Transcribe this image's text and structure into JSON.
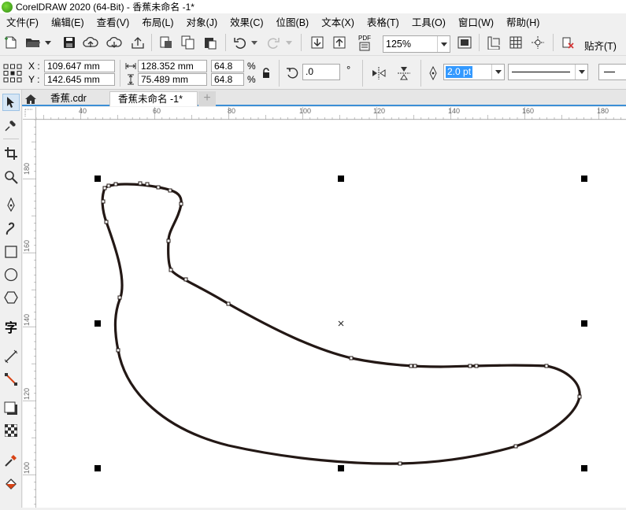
{
  "window": {
    "title": "CorelDRAW 2020 (64-Bit) - 香蕉未命名 -1*"
  },
  "menu": [
    "文件(F)",
    "编辑(E)",
    "查看(V)",
    "布局(L)",
    "对象(J)",
    "效果(C)",
    "位图(B)",
    "文本(X)",
    "表格(T)",
    "工具(O)",
    "窗口(W)",
    "帮助(H)"
  ],
  "toolbar": {
    "zoom_value": "125%",
    "snap_label": "贴齐(T)",
    "pdf_label": "PDF"
  },
  "properties": {
    "x_label": "X :",
    "y_label": "Y :",
    "x_value": "109.647 mm",
    "y_value": "142.645 mm",
    "width_value": "128.352 mm",
    "height_value": "75.489 mm",
    "scale_w": "64.8",
    "scale_h": "64.8",
    "percent": "%",
    "rotation_value": ".0",
    "degree": "°",
    "outline_width": "2.0 pt"
  },
  "tabs": {
    "file1": "香蕉.cdr",
    "file2": "香蕉未命名 -1*",
    "add": "+"
  },
  "rulers": {
    "h_ticks": [
      "40",
      "60",
      "80",
      "100",
      "120",
      "140",
      "160",
      "180"
    ],
    "v_ticks": [
      "180",
      "160",
      "140",
      "120",
      "100"
    ]
  },
  "colors": {
    "accent": "#3c8fd6",
    "selection_highlight": "#3399ff",
    "shape_outline": "#231815"
  },
  "icons": {
    "toolbox": [
      "pick-tool-icon",
      "freehand-pick-icon",
      "crop-tool-icon",
      "zoom-tool-icon",
      "freehand-tool-icon",
      "artistic-media-icon",
      "rectangle-tool-icon",
      "ellipse-tool-icon",
      "polygon-tool-icon",
      "text-tool-icon",
      "parallel-dimension-icon",
      "connector-tool-icon",
      "drop-shadow-icon",
      "transparency-icon",
      "eyedropper-icon",
      "interactive-fill-icon"
    ]
  }
}
